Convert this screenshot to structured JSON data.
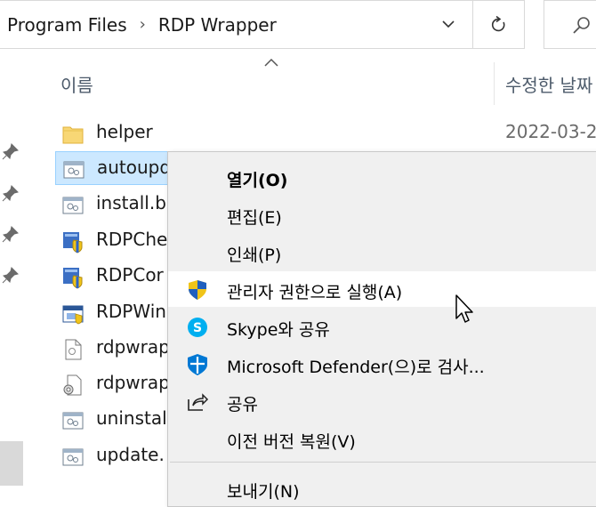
{
  "address_bar": {
    "crumbs": [
      "Program Files",
      "RDP Wrapper"
    ],
    "separator": "›"
  },
  "columns": {
    "name": "이름",
    "date": "수정한 날짜"
  },
  "files": [
    {
      "name": "helper",
      "date": "2022-03-2",
      "icon": "folder-icon"
    },
    {
      "name": "autoupd",
      "date": "",
      "icon": "batch-file-icon"
    },
    {
      "name": "install.b",
      "date": "",
      "icon": "batch-file-icon"
    },
    {
      "name": "RDPChe",
      "date": "",
      "icon": "shield-exe-icon"
    },
    {
      "name": "RDPCor",
      "date": "",
      "icon": "shield-exe-icon"
    },
    {
      "name": "RDPWin",
      "date": "",
      "icon": "app-window-icon"
    },
    {
      "name": "rdpwrap",
      "date": "",
      "icon": "document-icon"
    },
    {
      "name": "rdpwrap",
      "date": "",
      "icon": "dll-gear-icon"
    },
    {
      "name": "uninstal",
      "date": "",
      "icon": "batch-file-icon"
    },
    {
      "name": "update.",
      "date": "",
      "icon": "batch-file-icon"
    }
  ],
  "context_menu": {
    "items": [
      {
        "label": "열기(O)",
        "icon": ""
      },
      {
        "label": "편집(E)",
        "icon": ""
      },
      {
        "label": "인쇄(P)",
        "icon": ""
      },
      {
        "label": "관리자 권한으로 실행(A)",
        "icon": "uac-shield-icon"
      },
      {
        "label": "Skype와 공유",
        "icon": "skype-icon"
      },
      {
        "label": "Microsoft Defender(으)로 검사...",
        "icon": "defender-icon"
      },
      {
        "label": "공유",
        "icon": "share-icon"
      },
      {
        "label": "이전 버전 복원(V)",
        "icon": ""
      },
      {
        "label": "보내기(N)",
        "icon": ""
      }
    ]
  },
  "colors": {
    "selection_bg": "#cce8ff",
    "menu_bg": "#f0f0f0",
    "hover_bg": "#ffffff",
    "folder": "#f8d775",
    "uac_blue": "#1f5fbf",
    "skype": "#00aff0",
    "defender": "#0078d4"
  }
}
